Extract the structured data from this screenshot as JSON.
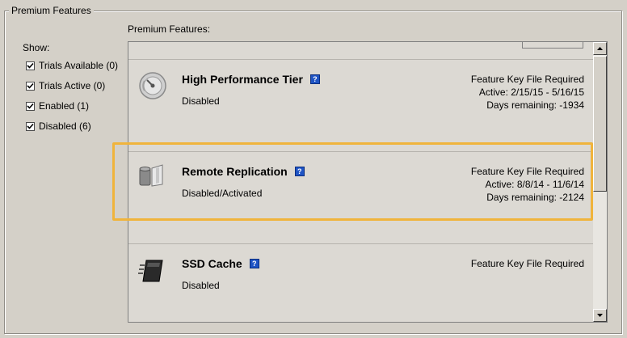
{
  "group_title": "Premium Features",
  "show_label": "Show:",
  "filters": [
    {
      "label": "Trials Available (0)",
      "checked": true
    },
    {
      "label": "Trials Active (0)",
      "checked": true
    },
    {
      "label": "Enabled (1)",
      "checked": true
    },
    {
      "label": "Disabled (6)",
      "checked": true
    }
  ],
  "list_label": "Premium Features:",
  "features": [
    {
      "name": "High Performance Tier",
      "status": "Disabled",
      "icon": "speedometer-icon",
      "meta": [
        "Feature Key File Required",
        "Active: 2/15/15 - 5/16/15",
        "Days remaining: -1934"
      ]
    },
    {
      "name": "Remote Replication",
      "status": "Disabled/Activated",
      "icon": "replication-icon",
      "meta": [
        "Feature Key File Required",
        "Active: 8/8/14 - 11/6/14",
        "Days remaining: -2124"
      ]
    },
    {
      "name": "SSD Cache",
      "status": "Disabled",
      "icon": "ssd-icon",
      "meta": [
        "Feature Key File Required"
      ]
    }
  ],
  "help_glyph": "?",
  "colors": {
    "highlight": "#f0b43c",
    "help": "#1f54c4"
  }
}
